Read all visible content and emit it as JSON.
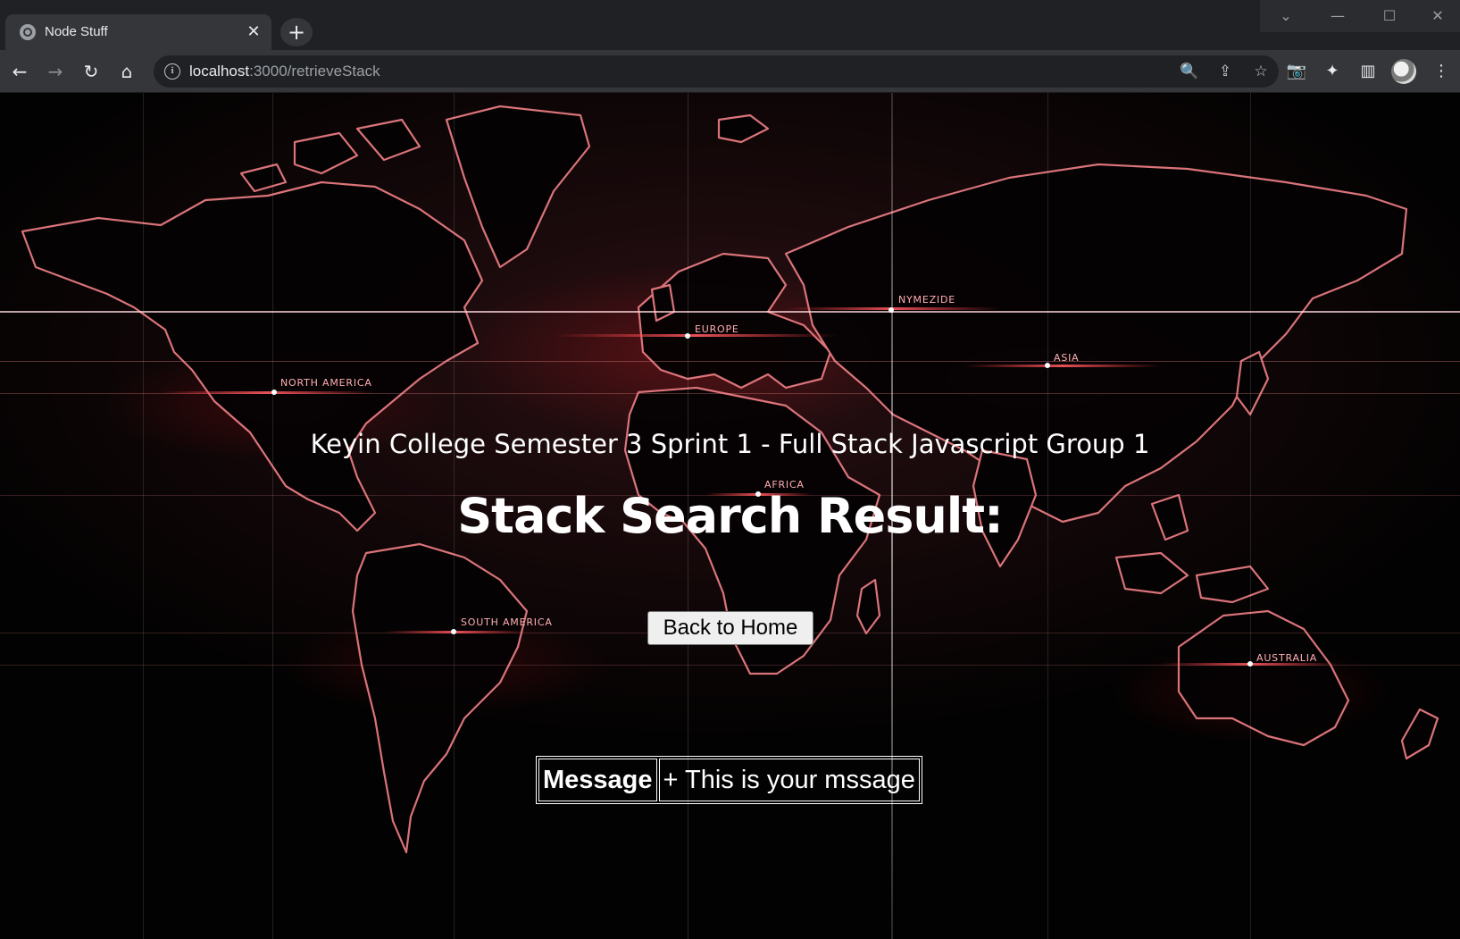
{
  "browser": {
    "tab_title": "Node Stuff",
    "tab_close": "✕",
    "new_tab": "+",
    "url_host": "localhost",
    "url_rest": ":3000/retrieveStack",
    "window_controls": {
      "tab_search": "⌄",
      "minimize": "—",
      "maximize": "☐",
      "close": "✕"
    },
    "toolbar_icons": {
      "back": "←",
      "forward": "→",
      "reload": "↻",
      "home": "⌂",
      "info": "i",
      "zoom": "🔍",
      "share": "⇪",
      "bookmark": "☆",
      "camera": "📷",
      "extensions": "✦",
      "side_panel": "▥",
      "menu": "⋮"
    }
  },
  "map_labels": [
    "NORTH AMERICA",
    "EUROPE",
    "NYMEZIDE",
    "ASIA",
    "AFRICA",
    "SOUTH AMERICA",
    "AUSTRALIA"
  ],
  "page": {
    "subtitle": "Keyin College Semester 3 Sprint 1 - Full Stack Javascript Group 1",
    "heading": "Stack Search Result:",
    "home_button": "Back to Home",
    "message_header": "Message",
    "message_value": "+ This is your mssage"
  },
  "colors": {
    "accent_red": "#e0202a",
    "page_background": "#0a0506",
    "chrome_dark": "#202124",
    "chrome_tab": "#35363a"
  }
}
